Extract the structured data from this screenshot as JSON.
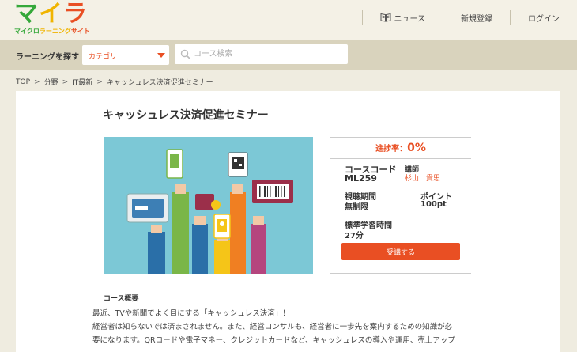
{
  "brand": {
    "logo_chars": [
      "マ",
      "イ",
      "ラ"
    ],
    "tagline_parts": [
      "マイクロ",
      "ラーニング",
      "サイト"
    ],
    "colors": {
      "green": "#35a83a",
      "yellow": "#f0b400",
      "orange": "#e94f23"
    }
  },
  "nav": {
    "news": "ニュース",
    "signup": "新規登録",
    "login": "ログイン",
    "news_icon": "book-icon"
  },
  "search": {
    "label": "ラーニングを探す",
    "category_value": "カテゴリ",
    "keyword_placeholder": "コース検索"
  },
  "breadcrumb": [
    "TOP",
    "分野",
    "IT最新",
    "キャッシュレス決済促進セミナー"
  ],
  "course": {
    "title": "キャッシュレス決済促進セミナー",
    "progress_label": "進捗率：",
    "progress_value": "0%",
    "progress_fraction": 0,
    "code_label": "コースコード",
    "code_value": "ML259",
    "instructor_label": "講師",
    "instructor_value": "杉山　貴思",
    "period_label": "視聴期間",
    "period_value": "無制限",
    "points_label": "ポイント",
    "points_value": "100pt",
    "study_time_label": "標準学習時間",
    "study_time_value": "27分",
    "enroll_label": "受講する",
    "image_background": "#7cc8d6"
  },
  "overview": {
    "heading": "コース概要",
    "lines": [
      "最近、TVや新聞でよく目にする「キャッシュレス決済」！",
      "経営者は知らないでは済まされません。また、経営コンサルも、経営者に一歩先を案内するための知識が必",
      "要になります。QRコードや電子マネー、クレジットカードなど、キャッシュレスの導入や運用、売上アップ"
    ]
  }
}
